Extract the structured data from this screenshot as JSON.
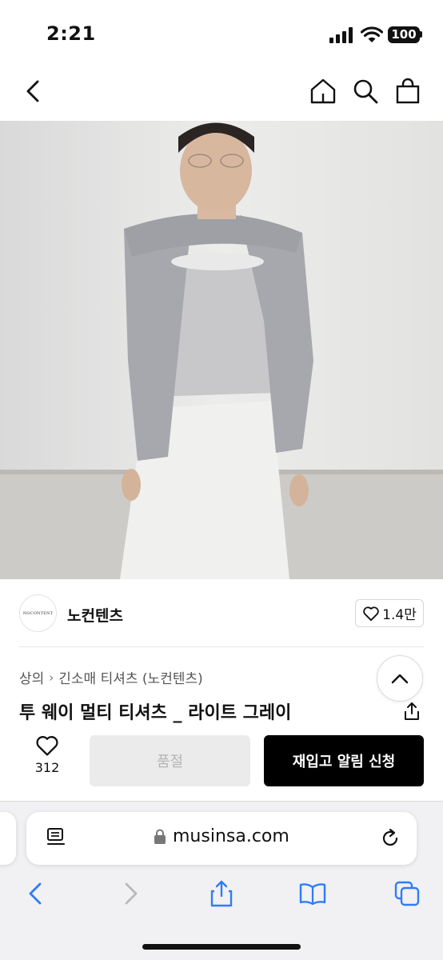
{
  "status_bar": {
    "time": "2:21",
    "battery": "100"
  },
  "header": {
    "back_icon": "chevron-left-icon",
    "home_icon": "home-icon",
    "search_icon": "search-icon",
    "cart_icon": "shopping-bag-icon"
  },
  "product_image": {
    "description_icon": "model-photo"
  },
  "brand": {
    "logo_text": "NOCONTENT",
    "name": "노컨텐츠",
    "likes": "1.4만"
  },
  "breadcrumb": [
    "상의",
    "긴소매 티셔츠 (노컨텐츠)"
  ],
  "product": {
    "title": "투 웨이 멀티 티셔츠 _ 라이트 그레이"
  },
  "purchase_bar": {
    "wish_count": "312",
    "soldout_label": "품절",
    "restock_label": "재입고 알림 신청"
  },
  "browser": {
    "url": "musinsa.com"
  },
  "colors": {
    "accent_button": "#000000",
    "disabled_button": "#ebebeb",
    "safari_blue": "#2f7cf6"
  }
}
